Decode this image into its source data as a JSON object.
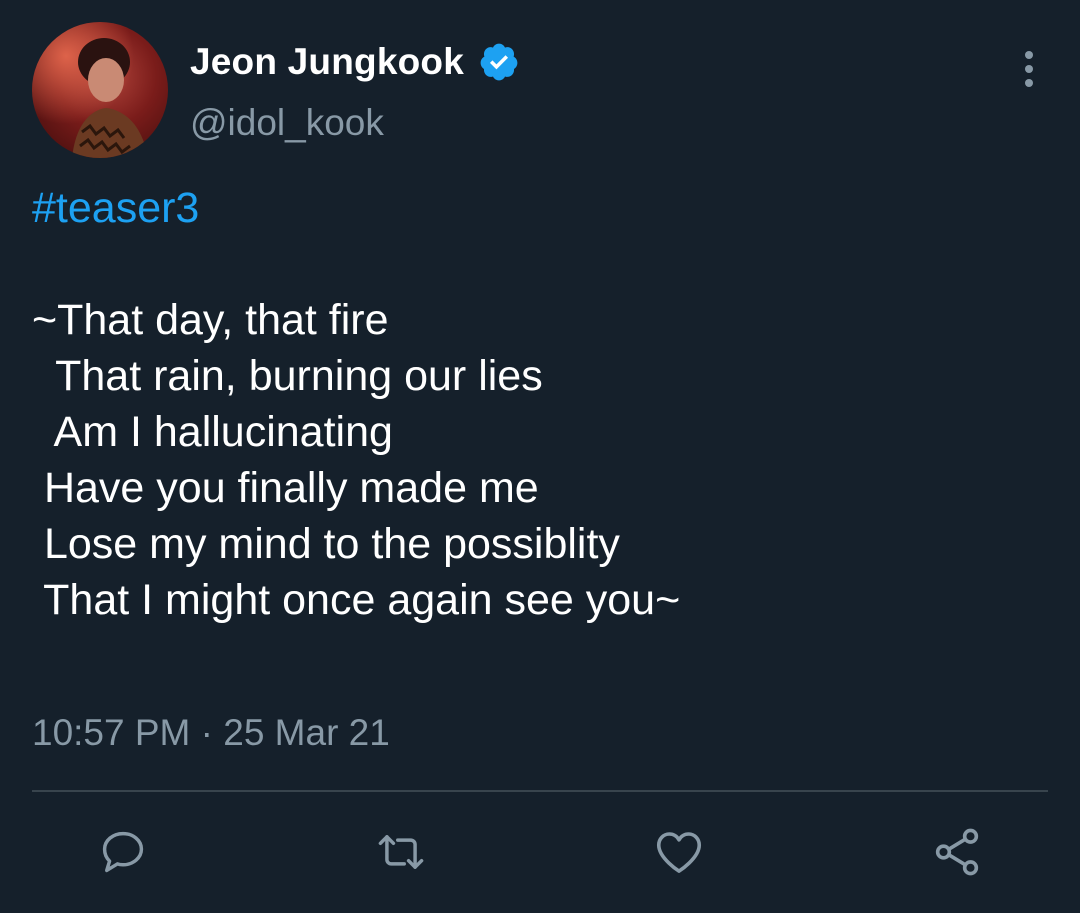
{
  "author": {
    "display_name": "Jeon Jungkook",
    "handle": "@idol_kook",
    "verified": true
  },
  "tweet": {
    "hashtag": "#teaser3",
    "body": "~That day, that fire\n  That rain, burning our lies\n  Am I hallucinating\n Have you finally made me\n Lose my mind to the possiblity\n That I might once again see you~",
    "timestamp": "10:57 PM · 25 Mar 21"
  },
  "icons": {
    "verified": "verified-badge-icon",
    "more": "more-vertical-icon",
    "reply": "reply-icon",
    "retweet": "retweet-icon",
    "like": "heart-icon",
    "share": "share-icon"
  },
  "colors": {
    "background": "#15202b",
    "accent": "#1da1f2",
    "secondary_text": "#8899a6",
    "divider": "#38444d"
  }
}
